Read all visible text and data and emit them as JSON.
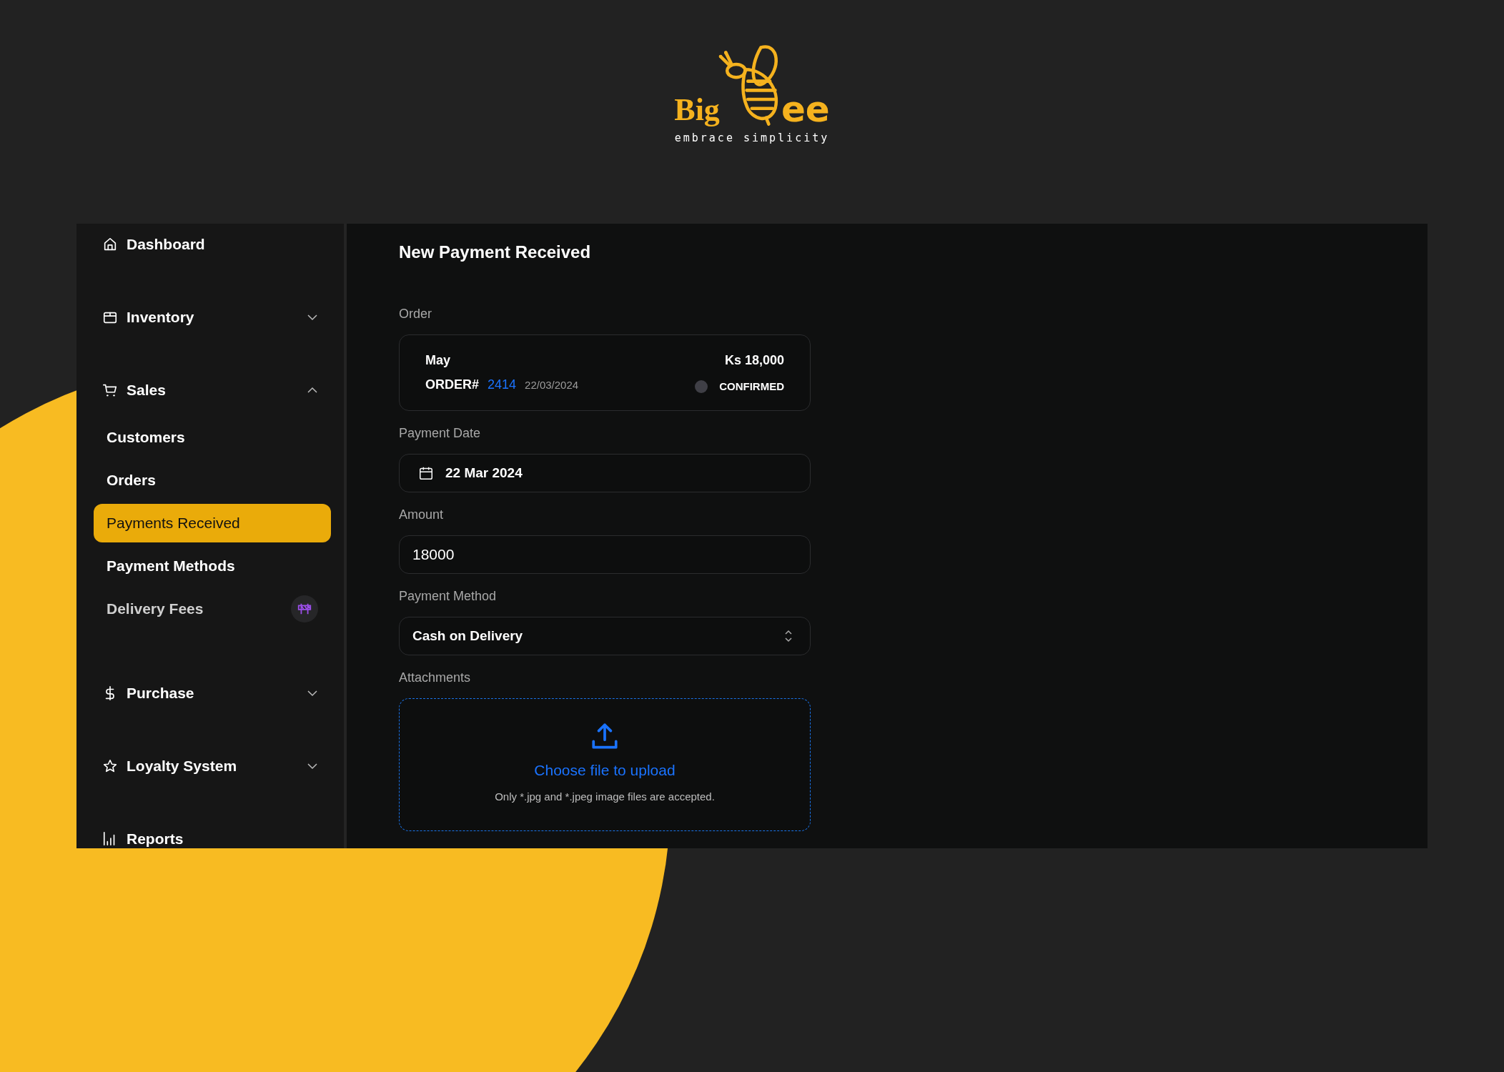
{
  "logo": {
    "text_left": "Big",
    "text_right": "ee",
    "tagline": "embrace simplicity"
  },
  "sidebar": {
    "items": [
      {
        "label": "Dashboard",
        "kind": "link"
      },
      {
        "label": "Inventory",
        "kind": "group",
        "expanded": false
      },
      {
        "label": "Sales",
        "kind": "group",
        "expanded": true,
        "children": [
          {
            "label": "Customers",
            "selected": false,
            "disabled": false
          },
          {
            "label": "Orders",
            "selected": false,
            "disabled": false
          },
          {
            "label": "Payments Received",
            "selected": true,
            "disabled": false
          },
          {
            "label": "Payment Methods",
            "selected": false,
            "disabled": false
          },
          {
            "label": "Delivery Fees",
            "selected": false,
            "disabled": true
          }
        ]
      },
      {
        "label": "Purchase",
        "kind": "group",
        "expanded": false
      },
      {
        "label": "Loyalty System",
        "kind": "group",
        "expanded": false
      },
      {
        "label": "Reports",
        "kind": "link"
      }
    ]
  },
  "form": {
    "title": "New Payment Received",
    "order": {
      "label": "Order",
      "customer": "May",
      "total": "Ks 18,000",
      "order_prefix": "ORDER#",
      "order_number": "2414",
      "date": "22/03/2024",
      "status": "CONFIRMED"
    },
    "fields": [
      {
        "kind": "date",
        "label": "Payment Date",
        "value": "22 Mar 2024"
      },
      {
        "kind": "text",
        "label": "Amount",
        "value": "18000"
      },
      {
        "kind": "select",
        "label": "Payment Method",
        "value": "Cash on Delivery"
      },
      {
        "kind": "upload",
        "label": "Attachments",
        "link": "Choose file to upload",
        "hint": "Only *.jpg and *.jpeg image files are accepted."
      }
    ]
  }
}
